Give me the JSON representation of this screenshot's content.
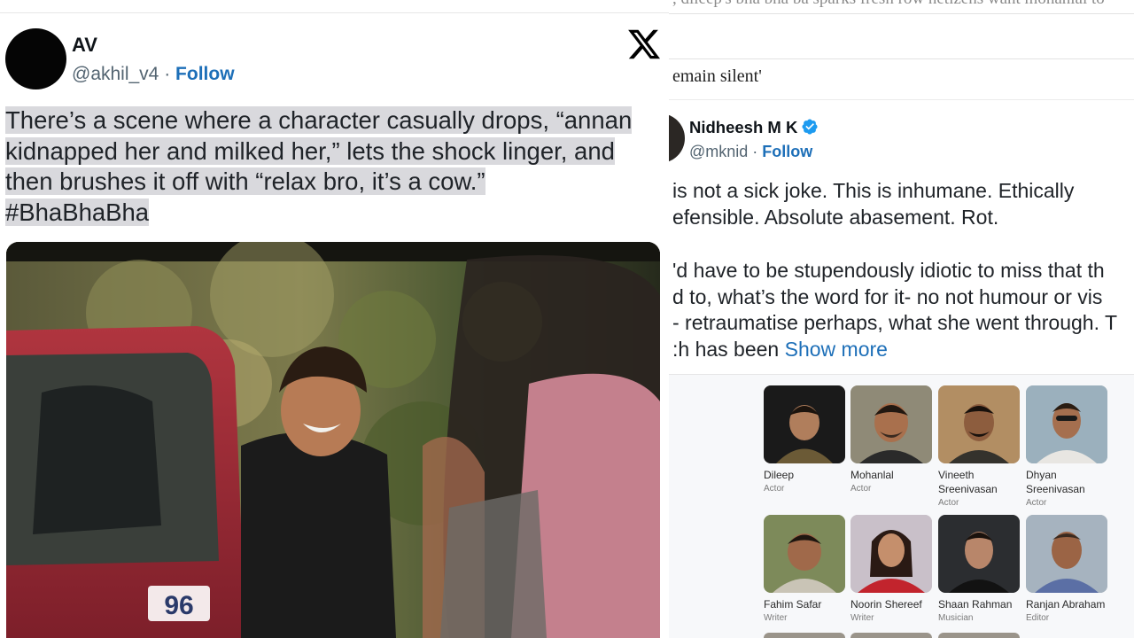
{
  "left_tweet": {
    "name": "AV",
    "handle": "@akhil_v4",
    "separator": " · ",
    "follow_label": "Follow",
    "text_lines": [
      "There’s a scene where a character casually drops, “annan",
      "kidnapped her and milked her,” lets the shock linger, and",
      "then brushes it off with “relax bro, it’s a cow.”",
      "#BhaBhaBha"
    ],
    "media": {
      "plate_number": "96"
    },
    "icon": "x-logo-icon"
  },
  "right_panel": {
    "cut_headline": ", dileep's bha bha ba sparks fresh row netizens want mohanlal to",
    "headline_tail": "emain silent'",
    "reply_tweet": {
      "name": "Nidheesh M K",
      "handle": "@mknid",
      "separator": " · ",
      "follow_label": "Follow",
      "verified_color": "#1d9bf0",
      "lines": [
        " is not a sick joke. This is inhumane. Ethically",
        "efensible. Absolute abasement. Rot.",
        "'d have to be stupendously idiotic to miss that th",
        "d to, what’s the word for it- no not humour or vis",
        "- retraumatise perhaps, what she went through. T",
        ":h has been "
      ],
      "show_more": "Show more"
    },
    "cast": [
      {
        "name": "Dileep",
        "role": "Actor"
      },
      {
        "name": "Mohanlal",
        "role": "Actor"
      },
      {
        "name": "Vineeth Sreenivasan",
        "role": "Actor"
      },
      {
        "name": "Dhyan Sreenivasan",
        "role": "Actor"
      },
      {
        "name": "Fahim Safar",
        "role": "Writer"
      },
      {
        "name": "Noorin Shereef",
        "role": "Writer"
      },
      {
        "name": "Shaan Rahman",
        "role": "Musician"
      },
      {
        "name": "Ranjan Abraham",
        "role": "Editor"
      }
    ]
  },
  "colors": {
    "link_blue": "#1d6fb8",
    "text_gray": "#536471",
    "highlight": "#d9d9dd"
  }
}
